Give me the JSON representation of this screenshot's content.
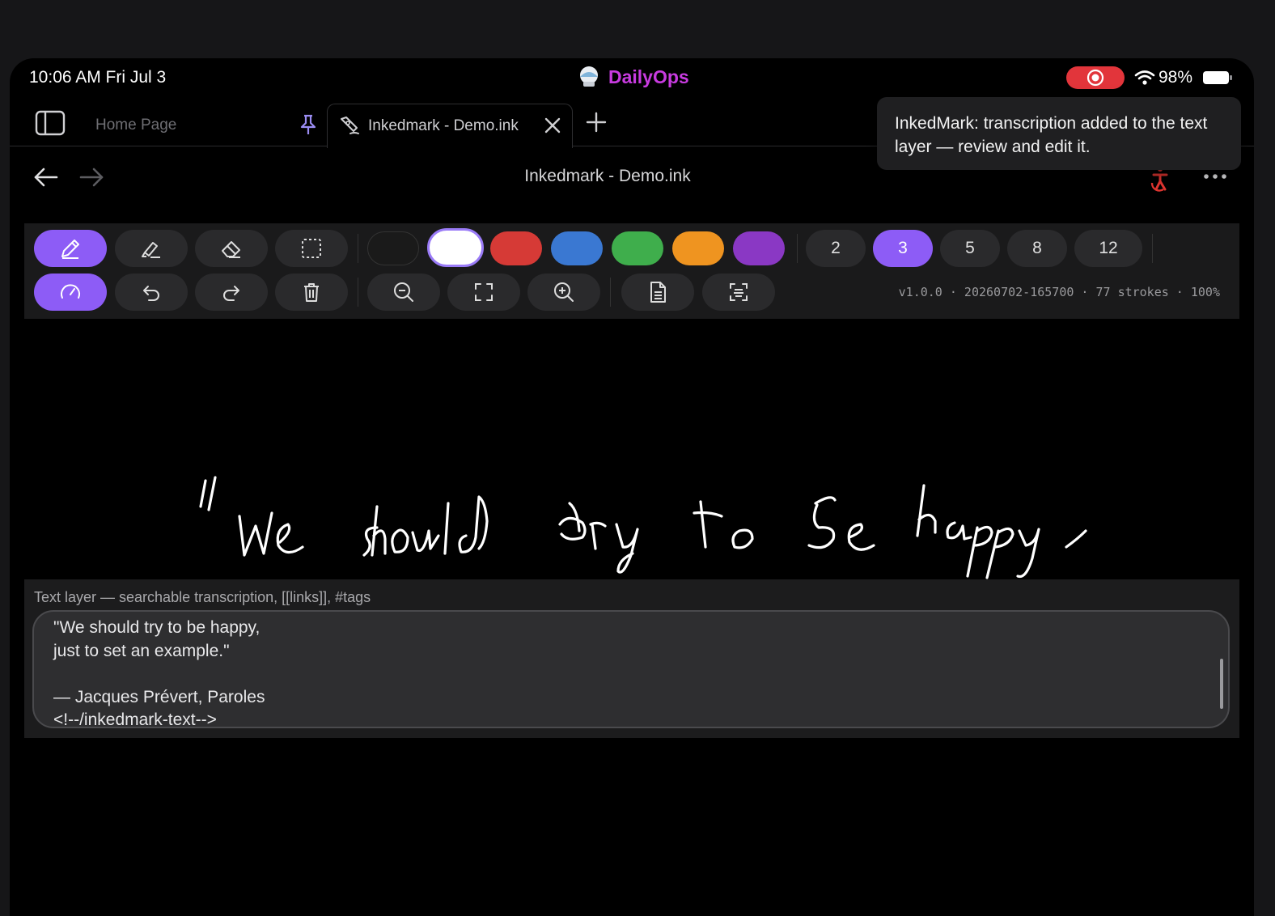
{
  "status": {
    "time": "10:06 AM  Fri Jul 3",
    "app_name": "DailyOps",
    "battery": "98%",
    "record_color": "#e2353b"
  },
  "tabs": {
    "home_label": "Home Page",
    "active_label": "Inkedmark - Demo.ink"
  },
  "toast": {
    "message": "InkedMark: transcription added to the text layer — review and edit it."
  },
  "nav": {
    "title": "Inkedmark - Demo.ink"
  },
  "toolbar": {
    "tools_row1": [
      "pen-icon",
      "highlighter-icon",
      "eraser-icon",
      "lasso-select-icon"
    ],
    "tools_row2": [
      "pressure-gauge-icon",
      "undo-icon",
      "redo-icon",
      "trash-icon"
    ],
    "view_tools": [
      "zoom-out-icon",
      "fit-screen-icon",
      "zoom-in-icon"
    ],
    "doc_tools": [
      "document-icon",
      "transcribe-icon"
    ],
    "colors": [
      "#1a1a1a",
      "#ffffff",
      "#d63a36",
      "#3a78d2",
      "#3fae4c",
      "#ef9420",
      "#8a38c4"
    ],
    "selected_color": "#ffffff",
    "accent": "#8d5cf6",
    "sizes": [
      "2",
      "3",
      "5",
      "8",
      "12"
    ],
    "selected_size": "3",
    "meta": "v1.0.0 · 20260702-165700 · 77 strokes · 100%"
  },
  "text_layer": {
    "label": "Text layer — searchable transcription, [[links]], #tags",
    "lines": [
      "\"We should try to be happy,",
      "just to set an example.\"",
      "",
      "— Jacques Prévert, Paroles",
      "<!--/inkedmark-text-->"
    ]
  }
}
